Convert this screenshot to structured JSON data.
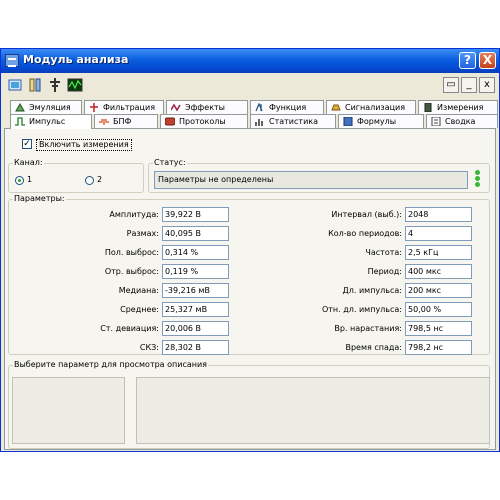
{
  "window": {
    "title": "Модуль анализа",
    "help_label": "?",
    "close_label": "X"
  },
  "toolbar": {
    "minimize_label": "_",
    "close_label": "x"
  },
  "tabs_row1": [
    {
      "label": "Эмуляция"
    },
    {
      "label": "Фильтрация"
    },
    {
      "label": "Эффекты"
    },
    {
      "label": "Функция"
    },
    {
      "label": "Сигнализация"
    },
    {
      "label": "Измерения"
    }
  ],
  "tabs_row2": [
    {
      "label": "Импульс"
    },
    {
      "label": "БПФ"
    },
    {
      "label": "Протоколы"
    },
    {
      "label": "Статистика"
    },
    {
      "label": "Формулы"
    },
    {
      "label": "Сводка"
    }
  ],
  "enable": {
    "label": "Включить измерения",
    "checked": true,
    "mark": "✓"
  },
  "channel": {
    "title": "Канал:",
    "options": [
      "1",
      "2"
    ],
    "selected": "1"
  },
  "status": {
    "title": "Статус:",
    "value": "Параметры не определены"
  },
  "params": {
    "title": "Параметры:",
    "left": [
      {
        "label": "Амплитуда:",
        "value": "39,922 В"
      },
      {
        "label": "Размах:",
        "value": "40,095 В"
      },
      {
        "label": "Пол. выброс:",
        "value": "0,314 %"
      },
      {
        "label": "Отр. выброс:",
        "value": "0,119 %"
      },
      {
        "label": "Медиана:",
        "value": "-39,216 мВ"
      },
      {
        "label": "Среднее:",
        "value": "25,327 мВ"
      },
      {
        "label": "Ст. девиация:",
        "value": "20,006 В"
      },
      {
        "label": "СКЗ:",
        "value": "28,302 В"
      }
    ],
    "right": [
      {
        "label": "Интервал (выб.):",
        "value": "2048"
      },
      {
        "label": "Кол-во периодов:",
        "value": "4"
      },
      {
        "label": "Частота:",
        "value": "2,5 кГц"
      },
      {
        "label": "Период:",
        "value": "400 мкс"
      },
      {
        "label": "Дл. импульса:",
        "value": "200 мкс"
      },
      {
        "label": "Отн. дл. импульса:",
        "value": "50,00 %"
      },
      {
        "label": "Вр. нарастания:",
        "value": "798,5 нс"
      },
      {
        "label": "Время спада:",
        "value": "798,2 нс"
      }
    ]
  },
  "description": {
    "title": "Выберите параметр для просмотра описания"
  },
  "colors": {
    "title_bar": "#0a5fe0",
    "window_bg": "#ece9d8",
    "status_led": "#3ab83a"
  }
}
